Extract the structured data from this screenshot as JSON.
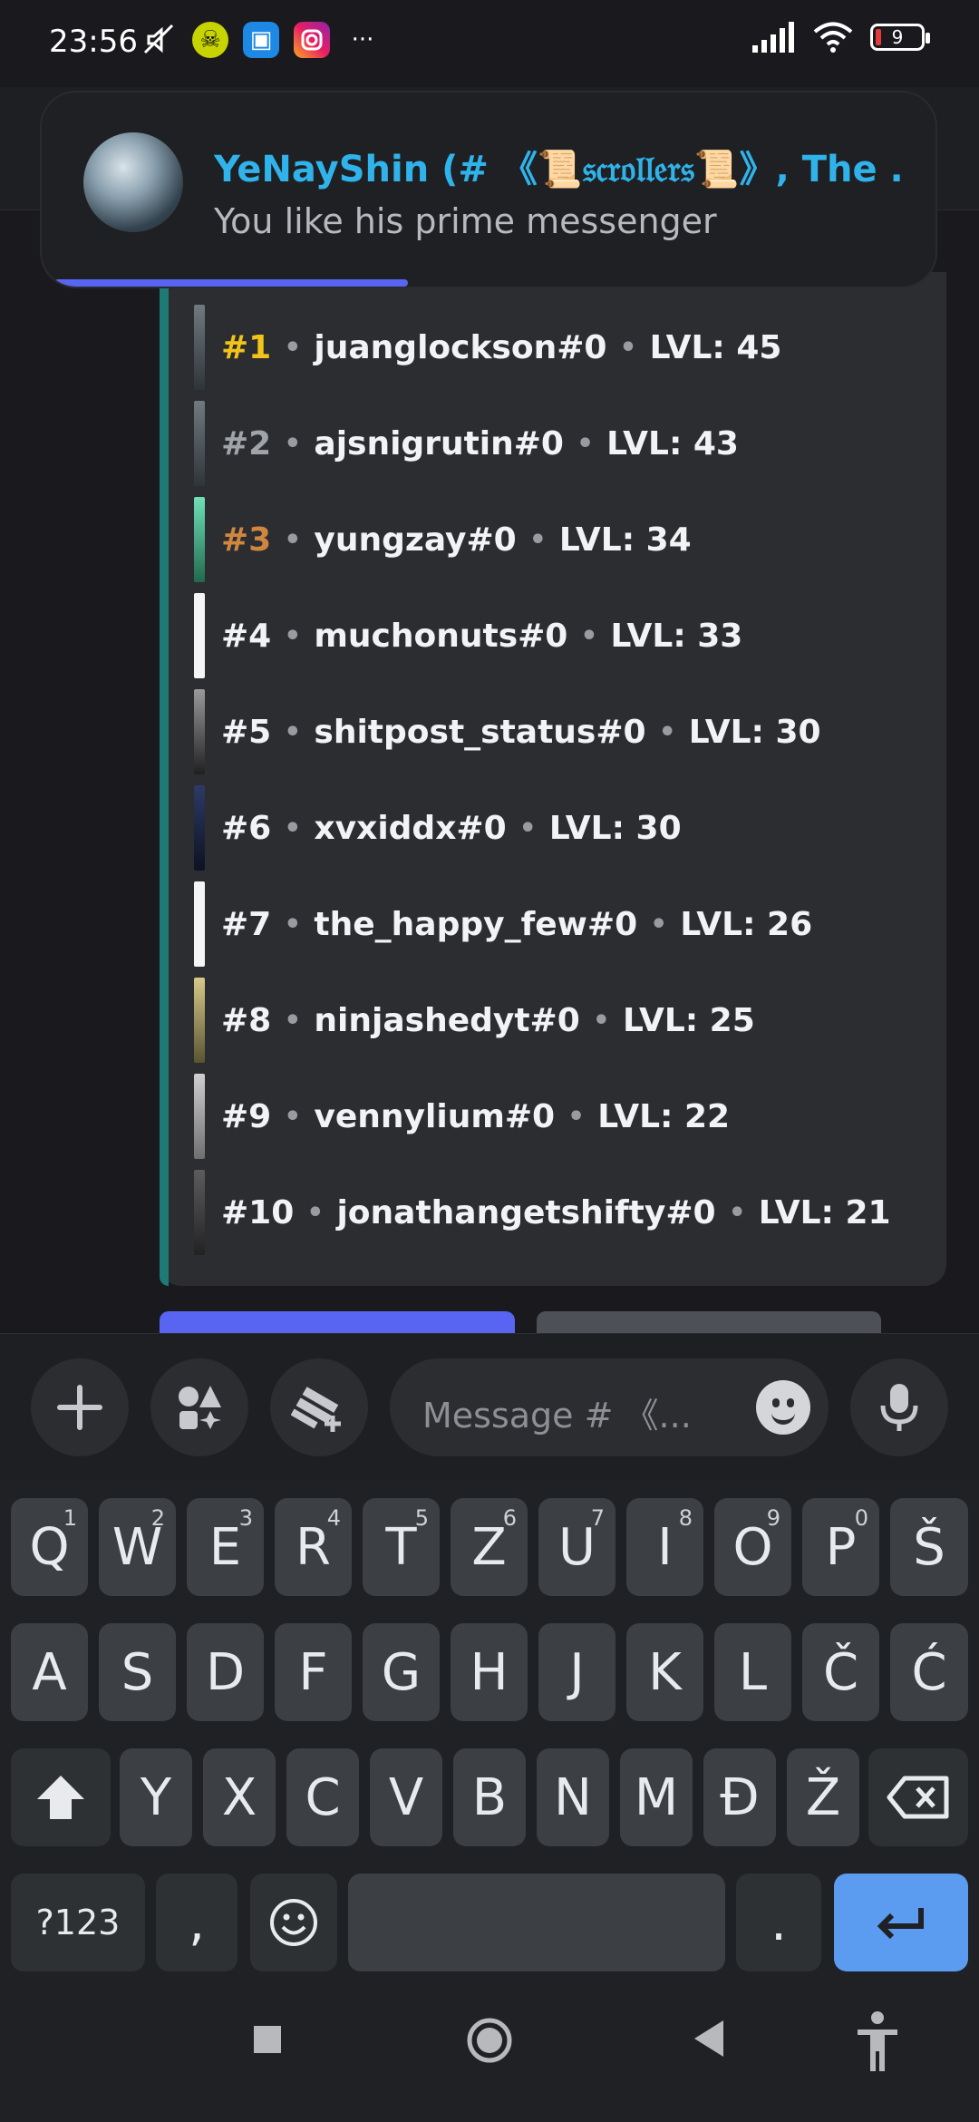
{
  "status_bar": {
    "time": "23:56",
    "battery": "9",
    "icons_left": [
      "mute-icon",
      "game-icon",
      "app-icon",
      "instagram-icon",
      "more-icon"
    ],
    "icons_right": [
      "signal-icon",
      "wifi-icon",
      "battery-icon"
    ]
  },
  "notification": {
    "title": "YeNayShin (# 《📜𝔰𝔠𝔯𝔬𝔩𝔩𝔢𝔯𝔰📜》, The ...",
    "message": "You like his prime messenger",
    "accent": "#2fb3ea"
  },
  "leaderboard": {
    "entries": [
      {
        "rank": "#1",
        "user": "juanglockson#0",
        "level": "LVL: 45"
      },
      {
        "rank": "#2",
        "user": "ajsnigrutin#0",
        "level": "LVL: 43"
      },
      {
        "rank": "#3",
        "user": "yungzay#0",
        "level": "LVL: 34"
      },
      {
        "rank": "#4",
        "user": "muchonuts#0",
        "level": "LVL: 33"
      },
      {
        "rank": "#5",
        "user": "shitpost_status#0",
        "level": "LVL: 30"
      },
      {
        "rank": "#6",
        "user": "xvxiddx#0",
        "level": "LVL: 30"
      },
      {
        "rank": "#7",
        "user": "the_happy_few#0",
        "level": "LVL: 26"
      },
      {
        "rank": "#8",
        "user": "ninjashedyt#0",
        "level": "LVL: 25"
      },
      {
        "rank": "#9",
        "user": "vennylium#0",
        "level": "LVL: 22"
      },
      {
        "rank": "#10",
        "user": "jonathangetshifty#0",
        "level": "LVL: 21"
      }
    ],
    "separator": "•",
    "colors": {
      "gold": "#f0c419",
      "silver": "#a0a3a8",
      "bronze": "#cf8740"
    }
  },
  "composer": {
    "placeholder": "Message # 《...",
    "buttons": [
      "plus-icon",
      "apps-icon",
      "gift-icon",
      "emoji-icon",
      "microphone-icon"
    ]
  },
  "keyboard": {
    "row1": [
      {
        "k": "Q",
        "h": "1"
      },
      {
        "k": "W",
        "h": "2"
      },
      {
        "k": "E",
        "h": "3"
      },
      {
        "k": "R",
        "h": "4"
      },
      {
        "k": "T",
        "h": "5"
      },
      {
        "k": "Z",
        "h": "6"
      },
      {
        "k": "U",
        "h": "7"
      },
      {
        "k": "I",
        "h": "8"
      },
      {
        "k": "O",
        "h": "9"
      },
      {
        "k": "P",
        "h": "0"
      },
      {
        "k": "Š",
        "h": ""
      }
    ],
    "row2": [
      "A",
      "S",
      "D",
      "F",
      "G",
      "H",
      "J",
      "K",
      "L",
      "Č",
      "Ć"
    ],
    "row3": [
      "Y",
      "X",
      "C",
      "V",
      "B",
      "N",
      "M",
      "Đ",
      "Ž"
    ],
    "sym": "?123",
    "comma": ",",
    "period": "."
  },
  "nav": [
    "recents-icon",
    "home-icon",
    "back-icon",
    "accessibility-icon"
  ]
}
